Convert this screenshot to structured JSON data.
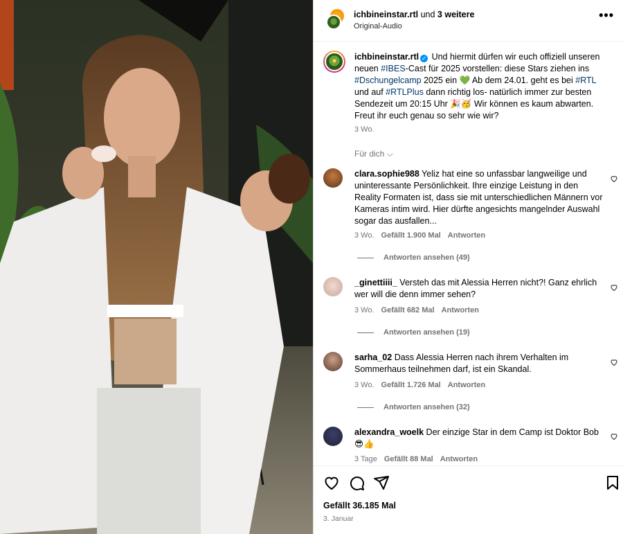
{
  "header": {
    "username": "ichbineinstar.rtl",
    "and_text": "und",
    "others": "3 weitere",
    "audio": "Original-Audio",
    "more_label": "•••"
  },
  "caption": {
    "username": "ichbineinstar.rtl",
    "part1": " Und hiermit dürfen wir euch offiziell unseren neuen ",
    "tag1": "#IBES",
    "part2": "-Cast für 2025 vorstellen: diese Stars ziehen ins ",
    "tag2": "#Dschungelcamp",
    "part3": " 2025 ein 💚 Ab dem 24.01. geht es bei ",
    "tag3": "#RTL",
    "part4": " und auf ",
    "tag4": "#RTLPlus",
    "part5": " dann richtig los- natürlich immer zur besten Sendezeit um 20:15 Uhr 🎉🥳 Wir können es kaum abwarten. Freut ihr euch genau so sehr wie wir?",
    "time": "3 Wo.",
    "for_you": "Für dich ⌵"
  },
  "comments": [
    {
      "username": "clara.sophie988",
      "text": " Yeliz hat eine so unfassbar langweilige und uninteressante Persönlichkeit. Ihre einzige Leistung in den Reality Formaten ist, dass sie mit unterschiedlichen Männern vor Kameras intim wird. Hier dürfte angesichts mangelnder Auswahl sogar das ausfallen...",
      "time": "3 Wo.",
      "likes": "Gefällt 1.900 Mal",
      "reply": "Antworten",
      "view_replies": "Antworten ansehen (49)"
    },
    {
      "username": "_ginettiiii_",
      "text": " Versteh das mit Alessia Herren nicht?! Ganz ehrlich wer will die denn immer sehen?",
      "time": "3 Wo.",
      "likes": "Gefällt 682 Mal",
      "reply": "Antworten",
      "view_replies": "Antworten ansehen (19)"
    },
    {
      "username": "sarha_02",
      "text": " Dass Alessia Herren nach ihrem Verhalten im Sommerhaus teilnehmen darf, ist ein Skandal.",
      "time": "3 Wo.",
      "likes": "Gefällt 1.726 Mal",
      "reply": "Antworten",
      "view_replies": "Antworten ansehen (32)"
    },
    {
      "username": "alexandra_woelk",
      "text": " Der einzige Star in dem Camp ist Doktor Bob 😎👍",
      "time": "3 Tage",
      "likes": "Gefällt 88 Mal",
      "reply": "Antworten"
    }
  ],
  "footer": {
    "likes": "Gefällt 36.185 Mal",
    "date": "3. Januar"
  },
  "icons": {
    "like": "heart-icon",
    "comment": "comment-icon",
    "share": "send-icon",
    "save": "bookmark-icon"
  },
  "colors": {
    "link": "#00376b",
    "muted": "#737373",
    "verified": "#0095f6"
  }
}
